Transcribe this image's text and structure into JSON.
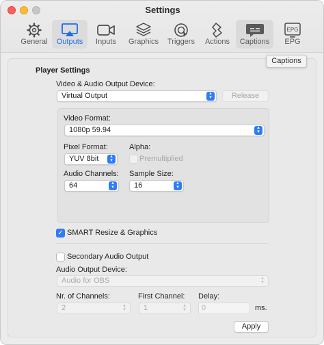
{
  "window": {
    "title": "Settings"
  },
  "toolbar": {
    "tabs": [
      {
        "label": "General",
        "icon": "gear-icon"
      },
      {
        "label": "Outputs",
        "icon": "airplay-display-icon"
      },
      {
        "label": "Inputs",
        "icon": "video-camera-icon"
      },
      {
        "label": "Graphics",
        "icon": "layers-stack-icon"
      },
      {
        "label": "Triggers",
        "icon": "trigger-dial-icon"
      },
      {
        "label": "Actions",
        "icon": "actions-bolt-icon"
      },
      {
        "label": "Captions",
        "icon": "captions-icon"
      },
      {
        "label": "EPG",
        "icon": "epg-icon"
      }
    ],
    "active_tab": "Outputs"
  },
  "tooltip": {
    "text": "Captions"
  },
  "player": {
    "section_title": "Player Settings",
    "device_label": "Video & Audio Output Device:",
    "device_value": "Virtual Output",
    "release_label": "Release",
    "video_format_label": "Video Format:",
    "video_format_value": "1080p 59.94",
    "pixel_format_label": "Pixel Format:",
    "pixel_format_value": "YUV 8bit",
    "alpha_label": "Alpha:",
    "premultiplied_label": "Premultiplied",
    "audio_channels_label": "Audio Channels:",
    "audio_channels_value": "64",
    "sample_size_label": "Sample Size:",
    "sample_size_value": "16",
    "smart_resize_label": "SMART Resize & Graphics",
    "smart_resize_checked": true
  },
  "secondary": {
    "enable_label": "Secondary Audio Output",
    "enabled": false,
    "device_label": "Audio Output Device:",
    "device_value": "Audio for OBS",
    "channels_label": "Nr. of Channels:",
    "channels_value": "2",
    "first_channel_label": "First Channel:",
    "first_channel_value": "1",
    "delay_label": "Delay:",
    "delay_value": "0",
    "delay_unit": "ms."
  },
  "apply_label": "Apply",
  "colors": {
    "accent": "#2f7cf6",
    "active_tab_text": "#1a6fe8"
  }
}
